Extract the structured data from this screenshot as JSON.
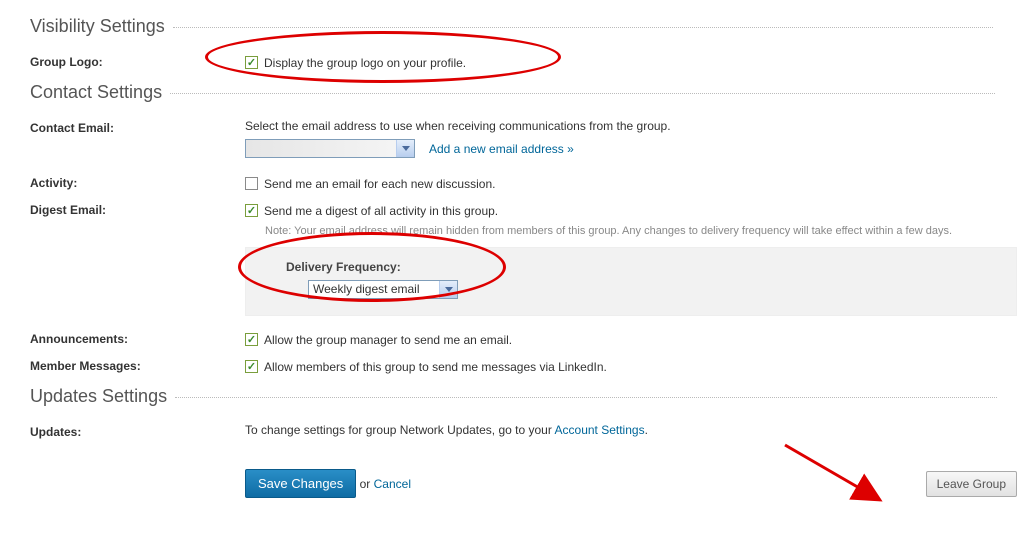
{
  "sections": {
    "visibility": "Visibility Settings",
    "contact": "Contact Settings",
    "updates": "Updates Settings"
  },
  "visibility": {
    "group_logo_label": "Group Logo:",
    "group_logo_text": "Display the group logo on your profile."
  },
  "contact": {
    "email_label": "Contact Email:",
    "email_help": "Select the email address to use when receiving communications from the group.",
    "add_email_link": "Add a new email address »",
    "activity_label": "Activity:",
    "activity_text": "Send me an email for each new discussion.",
    "digest_label": "Digest Email:",
    "digest_text": "Send me a digest of all activity in this group.",
    "digest_note": "Note: Your email address will remain hidden from members of this group. Any changes to delivery frequency will take effect within a few days.",
    "delivery_label": "Delivery Frequency:",
    "delivery_value": "Weekly digest email",
    "announcements_label": "Announcements:",
    "announcements_text": "Allow the group manager to send me an email.",
    "member_msgs_label": "Member Messages:",
    "member_msgs_text": "Allow members of this group to send me messages via LinkedIn."
  },
  "updates": {
    "updates_label": "Updates:",
    "updates_text_pre": "To change settings for group Network Updates, go to your ",
    "updates_link": "Account Settings",
    "updates_text_post": "."
  },
  "footer": {
    "save": "Save Changes",
    "or": " or ",
    "cancel": "Cancel",
    "leave": "Leave Group"
  }
}
